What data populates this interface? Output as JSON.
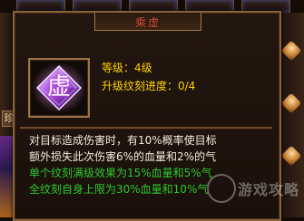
{
  "tooltip": {
    "title": "乘虚",
    "level_line": "等级：4级",
    "progress_line": "升级纹刻进度：0/4",
    "description": [
      "对目标造成伤害时，有10%概率使目标",
      "额外损失此次伤害6%的血量和2%的气"
    ],
    "bonus_lines": [
      "单个纹刻满级效果为15%血量和5%气",
      "全纹刻自身上限为30%血量和10%气"
    ],
    "icon": {
      "name": "rune-gem-icon",
      "glyph": "虚"
    }
  },
  "background": {
    "left_tab_label": "珍"
  },
  "watermark": {
    "text": "游戏攻略"
  },
  "colors": {
    "title": "#e2553a",
    "stats": "#ffd200",
    "description": "#f2ece0",
    "bonus": "#2ec82e",
    "border": "#8a6236"
  }
}
